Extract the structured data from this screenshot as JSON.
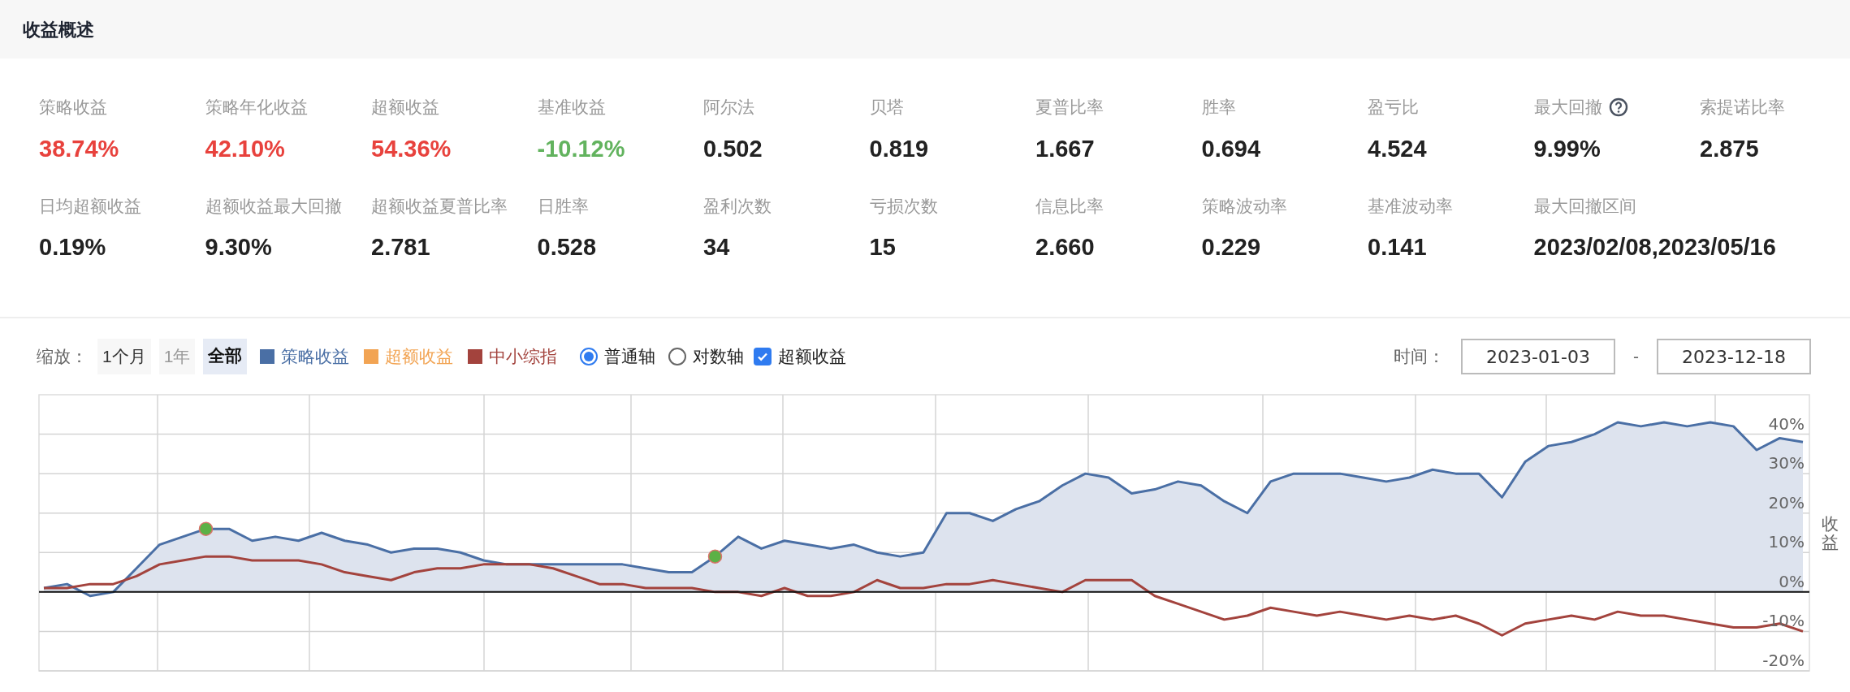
{
  "header": {
    "title": "收益概述"
  },
  "metrics": [
    {
      "label": "策略收益",
      "value": "38.74%",
      "color": "#e8423d"
    },
    {
      "label": "策略年化收益",
      "value": "42.10%",
      "color": "#e8423d"
    },
    {
      "label": "超额收益",
      "value": "54.36%",
      "color": "#e8423d"
    },
    {
      "label": "基准收益",
      "value": "-10.12%",
      "color": "#62b35e"
    },
    {
      "label": "阿尔法",
      "value": "0.502",
      "color": "#222222"
    },
    {
      "label": "贝塔",
      "value": "0.819",
      "color": "#222222"
    },
    {
      "label": "夏普比率",
      "value": "1.667",
      "color": "#222222"
    },
    {
      "label": "胜率",
      "value": "0.694",
      "color": "#222222"
    },
    {
      "label": "盈亏比",
      "value": "4.524",
      "color": "#222222"
    },
    {
      "label": "最大回撤",
      "value": "9.99%",
      "color": "#222222",
      "help": true
    },
    {
      "label": "索提诺比率",
      "value": "2.875",
      "color": "#222222"
    },
    {
      "label": "日均超额收益",
      "value": "0.19%",
      "color": "#222222"
    },
    {
      "label": "超额收益最大回撤",
      "value": "9.30%",
      "color": "#222222"
    },
    {
      "label": "超额收益夏普比率",
      "value": "2.781",
      "color": "#222222"
    },
    {
      "label": "日胜率",
      "value": "0.528",
      "color": "#222222"
    },
    {
      "label": "盈利次数",
      "value": "34",
      "color": "#222222"
    },
    {
      "label": "亏损次数",
      "value": "15",
      "color": "#222222"
    },
    {
      "label": "信息比率",
      "value": "2.660",
      "color": "#222222"
    },
    {
      "label": "策略波动率",
      "value": "0.229",
      "color": "#222222"
    },
    {
      "label": "基准波动率",
      "value": "0.141",
      "color": "#222222"
    },
    {
      "label": "最大回撤区间",
      "value": "2023/02/08,2023/05/16",
      "color": "#222222"
    }
  ],
  "toolbar": {
    "zoom_label": "缩放：",
    "zoom_buttons": [
      {
        "label": "1个月",
        "selected": false,
        "disabled": false
      },
      {
        "label": "1年",
        "selected": false,
        "disabled": true
      },
      {
        "label": "全部",
        "selected": true,
        "disabled": false
      }
    ],
    "legend": [
      {
        "label": "超额收益",
        "color": "#f2a453"
      }
    ],
    "axis_scale": [
      {
        "label": "普通轴",
        "selected": true
      },
      {
        "label": "对数轴",
        "selected": false
      }
    ],
    "excess_toggle": {
      "label": "超额收益",
      "checked": true
    },
    "date_range": {
      "label": "时间：",
      "from": "2023-01-03",
      "separator": "-",
      "to": "2023-12-18"
    }
  },
  "chart_data": {
    "type": "line",
    "ylabel": "收益",
    "ylim": [
      -20,
      50
    ],
    "yticks": [
      {
        "value": -20,
        "label": "-20%"
      },
      {
        "value": -10,
        "label": "-10%"
      },
      {
        "value": 0,
        "label": "0%"
      },
      {
        "value": 10,
        "label": "10%"
      },
      {
        "value": 20,
        "label": "20%"
      },
      {
        "value": 30,
        "label": "30%"
      },
      {
        "value": 40,
        "label": "40%"
      }
    ],
    "series": [
      {
        "name": "策略收益",
        "color": "#4a6fa5",
        "values": [
          1,
          2,
          -1,
          0,
          6,
          12,
          14,
          16,
          16,
          13,
          14,
          13,
          15,
          13,
          12,
          10,
          11,
          11,
          10,
          8,
          7,
          7,
          7,
          7,
          7,
          7,
          6,
          5,
          5,
          9,
          14,
          11,
          13,
          12,
          11,
          12,
          10,
          9,
          10,
          20,
          20,
          18,
          21,
          23,
          27,
          30,
          29,
          25,
          26,
          28,
          27,
          23,
          20,
          28,
          30,
          30,
          30,
          29,
          28,
          29,
          31,
          30,
          30,
          24,
          33,
          37,
          38,
          40,
          43,
          42,
          43,
          42,
          43,
          42,
          36,
          39,
          38
        ]
      },
      {
        "name": "中小综指",
        "color": "#a3433d",
        "values": [
          1,
          1,
          2,
          2,
          4,
          7,
          8,
          9,
          9,
          8,
          8,
          8,
          7,
          5,
          4,
          3,
          5,
          6,
          6,
          7,
          7,
          7,
          6,
          4,
          2,
          2,
          1,
          1,
          1,
          0,
          0,
          -1,
          1,
          -1,
          -1,
          0,
          3,
          1,
          1,
          2,
          2,
          3,
          2,
          1,
          0,
          3,
          3,
          3,
          -1,
          -3,
          -5,
          -7,
          -6,
          -4,
          -5,
          -6,
          -5,
          -6,
          -7,
          -6,
          -7,
          -6,
          -8,
          -11,
          -8,
          -7,
          -6,
          -7,
          -5,
          -6,
          -6,
          -7,
          -8,
          -9,
          -9,
          -8,
          -10
        ]
      }
    ],
    "grid": true
  }
}
